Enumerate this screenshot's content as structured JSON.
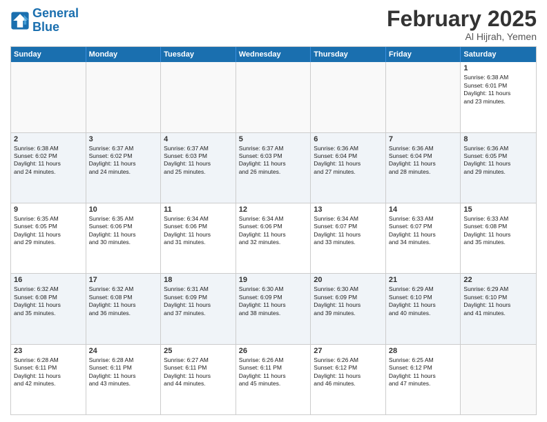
{
  "logo": {
    "line1": "General",
    "line2": "Blue"
  },
  "title": "February 2025",
  "location": "Al Hijrah, Yemen",
  "days": [
    "Sunday",
    "Monday",
    "Tuesday",
    "Wednesday",
    "Thursday",
    "Friday",
    "Saturday"
  ],
  "rows": [
    [
      {
        "day": "",
        "text": ""
      },
      {
        "day": "",
        "text": ""
      },
      {
        "day": "",
        "text": ""
      },
      {
        "day": "",
        "text": ""
      },
      {
        "day": "",
        "text": ""
      },
      {
        "day": "",
        "text": ""
      },
      {
        "day": "1",
        "text": "Sunrise: 6:38 AM\nSunset: 6:01 PM\nDaylight: 11 hours\nand 23 minutes."
      }
    ],
    [
      {
        "day": "2",
        "text": "Sunrise: 6:38 AM\nSunset: 6:02 PM\nDaylight: 11 hours\nand 24 minutes."
      },
      {
        "day": "3",
        "text": "Sunrise: 6:37 AM\nSunset: 6:02 PM\nDaylight: 11 hours\nand 24 minutes."
      },
      {
        "day": "4",
        "text": "Sunrise: 6:37 AM\nSunset: 6:03 PM\nDaylight: 11 hours\nand 25 minutes."
      },
      {
        "day": "5",
        "text": "Sunrise: 6:37 AM\nSunset: 6:03 PM\nDaylight: 11 hours\nand 26 minutes."
      },
      {
        "day": "6",
        "text": "Sunrise: 6:36 AM\nSunset: 6:04 PM\nDaylight: 11 hours\nand 27 minutes."
      },
      {
        "day": "7",
        "text": "Sunrise: 6:36 AM\nSunset: 6:04 PM\nDaylight: 11 hours\nand 28 minutes."
      },
      {
        "day": "8",
        "text": "Sunrise: 6:36 AM\nSunset: 6:05 PM\nDaylight: 11 hours\nand 29 minutes."
      }
    ],
    [
      {
        "day": "9",
        "text": "Sunrise: 6:35 AM\nSunset: 6:05 PM\nDaylight: 11 hours\nand 29 minutes."
      },
      {
        "day": "10",
        "text": "Sunrise: 6:35 AM\nSunset: 6:06 PM\nDaylight: 11 hours\nand 30 minutes."
      },
      {
        "day": "11",
        "text": "Sunrise: 6:34 AM\nSunset: 6:06 PM\nDaylight: 11 hours\nand 31 minutes."
      },
      {
        "day": "12",
        "text": "Sunrise: 6:34 AM\nSunset: 6:06 PM\nDaylight: 11 hours\nand 32 minutes."
      },
      {
        "day": "13",
        "text": "Sunrise: 6:34 AM\nSunset: 6:07 PM\nDaylight: 11 hours\nand 33 minutes."
      },
      {
        "day": "14",
        "text": "Sunrise: 6:33 AM\nSunset: 6:07 PM\nDaylight: 11 hours\nand 34 minutes."
      },
      {
        "day": "15",
        "text": "Sunrise: 6:33 AM\nSunset: 6:08 PM\nDaylight: 11 hours\nand 35 minutes."
      }
    ],
    [
      {
        "day": "16",
        "text": "Sunrise: 6:32 AM\nSunset: 6:08 PM\nDaylight: 11 hours\nand 35 minutes."
      },
      {
        "day": "17",
        "text": "Sunrise: 6:32 AM\nSunset: 6:08 PM\nDaylight: 11 hours\nand 36 minutes."
      },
      {
        "day": "18",
        "text": "Sunrise: 6:31 AM\nSunset: 6:09 PM\nDaylight: 11 hours\nand 37 minutes."
      },
      {
        "day": "19",
        "text": "Sunrise: 6:30 AM\nSunset: 6:09 PM\nDaylight: 11 hours\nand 38 minutes."
      },
      {
        "day": "20",
        "text": "Sunrise: 6:30 AM\nSunset: 6:09 PM\nDaylight: 11 hours\nand 39 minutes."
      },
      {
        "day": "21",
        "text": "Sunrise: 6:29 AM\nSunset: 6:10 PM\nDaylight: 11 hours\nand 40 minutes."
      },
      {
        "day": "22",
        "text": "Sunrise: 6:29 AM\nSunset: 6:10 PM\nDaylight: 11 hours\nand 41 minutes."
      }
    ],
    [
      {
        "day": "23",
        "text": "Sunrise: 6:28 AM\nSunset: 6:11 PM\nDaylight: 11 hours\nand 42 minutes."
      },
      {
        "day": "24",
        "text": "Sunrise: 6:28 AM\nSunset: 6:11 PM\nDaylight: 11 hours\nand 43 minutes."
      },
      {
        "day": "25",
        "text": "Sunrise: 6:27 AM\nSunset: 6:11 PM\nDaylight: 11 hours\nand 44 minutes."
      },
      {
        "day": "26",
        "text": "Sunrise: 6:26 AM\nSunset: 6:11 PM\nDaylight: 11 hours\nand 45 minutes."
      },
      {
        "day": "27",
        "text": "Sunrise: 6:26 AM\nSunset: 6:12 PM\nDaylight: 11 hours\nand 46 minutes."
      },
      {
        "day": "28",
        "text": "Sunrise: 6:25 AM\nSunset: 6:12 PM\nDaylight: 11 hours\nand 47 minutes."
      },
      {
        "day": "",
        "text": ""
      }
    ]
  ]
}
